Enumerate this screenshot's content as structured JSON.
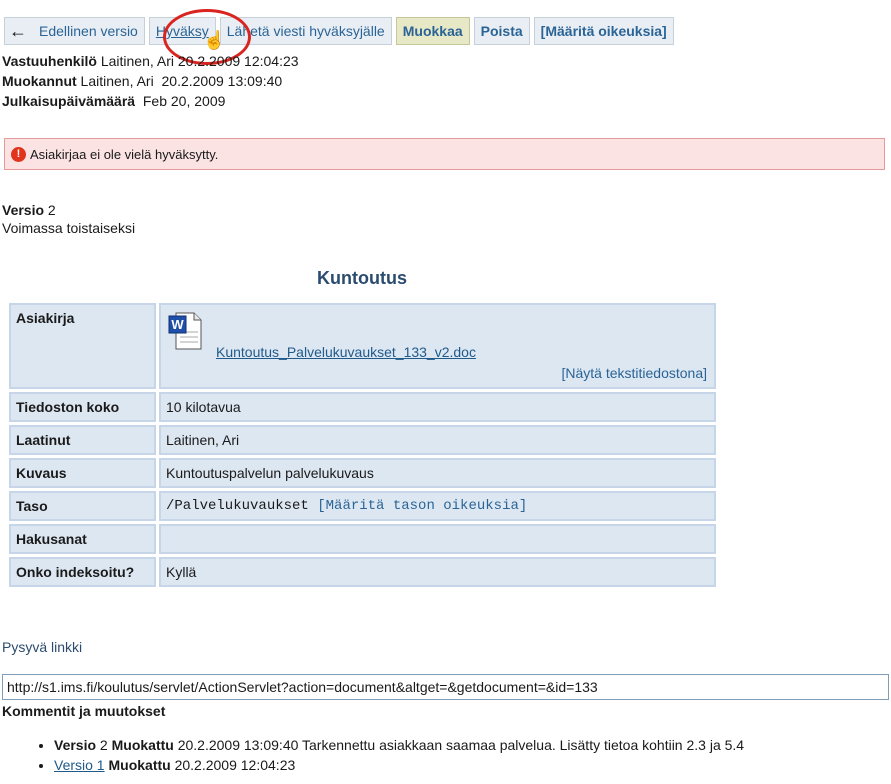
{
  "toolbar": {
    "back_label": "Edellinen versio",
    "approve_label": "Hyväksy",
    "send_label": "Lähetä viesti hyväksyjälle",
    "edit_label": "Muokkaa",
    "delete_label": "Poista",
    "permissions_label": "[Määritä oikeuksia]"
  },
  "meta": {
    "owner_key": "Vastuuhenkilö",
    "owner_value": "Laitinen, Ari",
    "owner_date": "20.2.2009 12:04:23",
    "modified_key": "Muokannut",
    "modified_value": "Laitinen, Ari",
    "modified_date": "20.2.2009 13:09:40",
    "publish_key": "Julkaisupäivämäärä",
    "publish_value": "Feb 20, 2009"
  },
  "warning": {
    "icon": "!",
    "text": "Asiakirjaa ei ole vielä hyväksytty."
  },
  "version": {
    "key": "Versio",
    "number": "2",
    "validity": "Voimassa toistaiseksi"
  },
  "document": {
    "title": "Kuntoutus",
    "file_key": "Asiakirja",
    "file_icon_letter": "W",
    "file_name": "Kuntoutus_Palvelukuvaukset_133_v2.doc",
    "text_link": "[Näytä tekstitiedostona]",
    "size_key": "Tiedoston koko",
    "size_value": "10 kilotavua",
    "author_key": "Laatinut",
    "author_value": "Laitinen, Ari",
    "desc_key": "Kuvaus",
    "desc_value": "Kuntoutuspalvelun palvelukuvaus",
    "level_key": "Taso",
    "level_value": "/Palvelukuvaukset",
    "level_link": "[Määritä tason oikeuksia]",
    "keywords_key": "Hakusanat",
    "keywords_value": "",
    "indexed_key": "Onko indeksoitu?",
    "indexed_value": "Kyllä"
  },
  "permalink": {
    "label": "Pysyvä linkki",
    "url": "http://s1.ims.fi/koulutus/servlet/ActionServlet?action=document&altget=&getdocument=&id=133"
  },
  "comments": {
    "heading": "Kommentit ja muutokset",
    "items": [
      {
        "version_key": "Versio",
        "version_number": "2",
        "modified_key": "Muokattu",
        "text": "20.2.2009 13:09:40 Tarkennettu asiakkaan saamaa palvelua. Lisätty tietoa kohtiin 2.3 ja 5.4"
      },
      {
        "version_link": "Versio 1",
        "modified_key": "Muokattu",
        "text": "20.2.2009 12:04:23"
      }
    ]
  },
  "colors": {
    "accent": "#2a6496",
    "highlight_circle": "#d9241f",
    "warning_bg": "#fbe3e3",
    "table_bg": "#dde7f2"
  }
}
